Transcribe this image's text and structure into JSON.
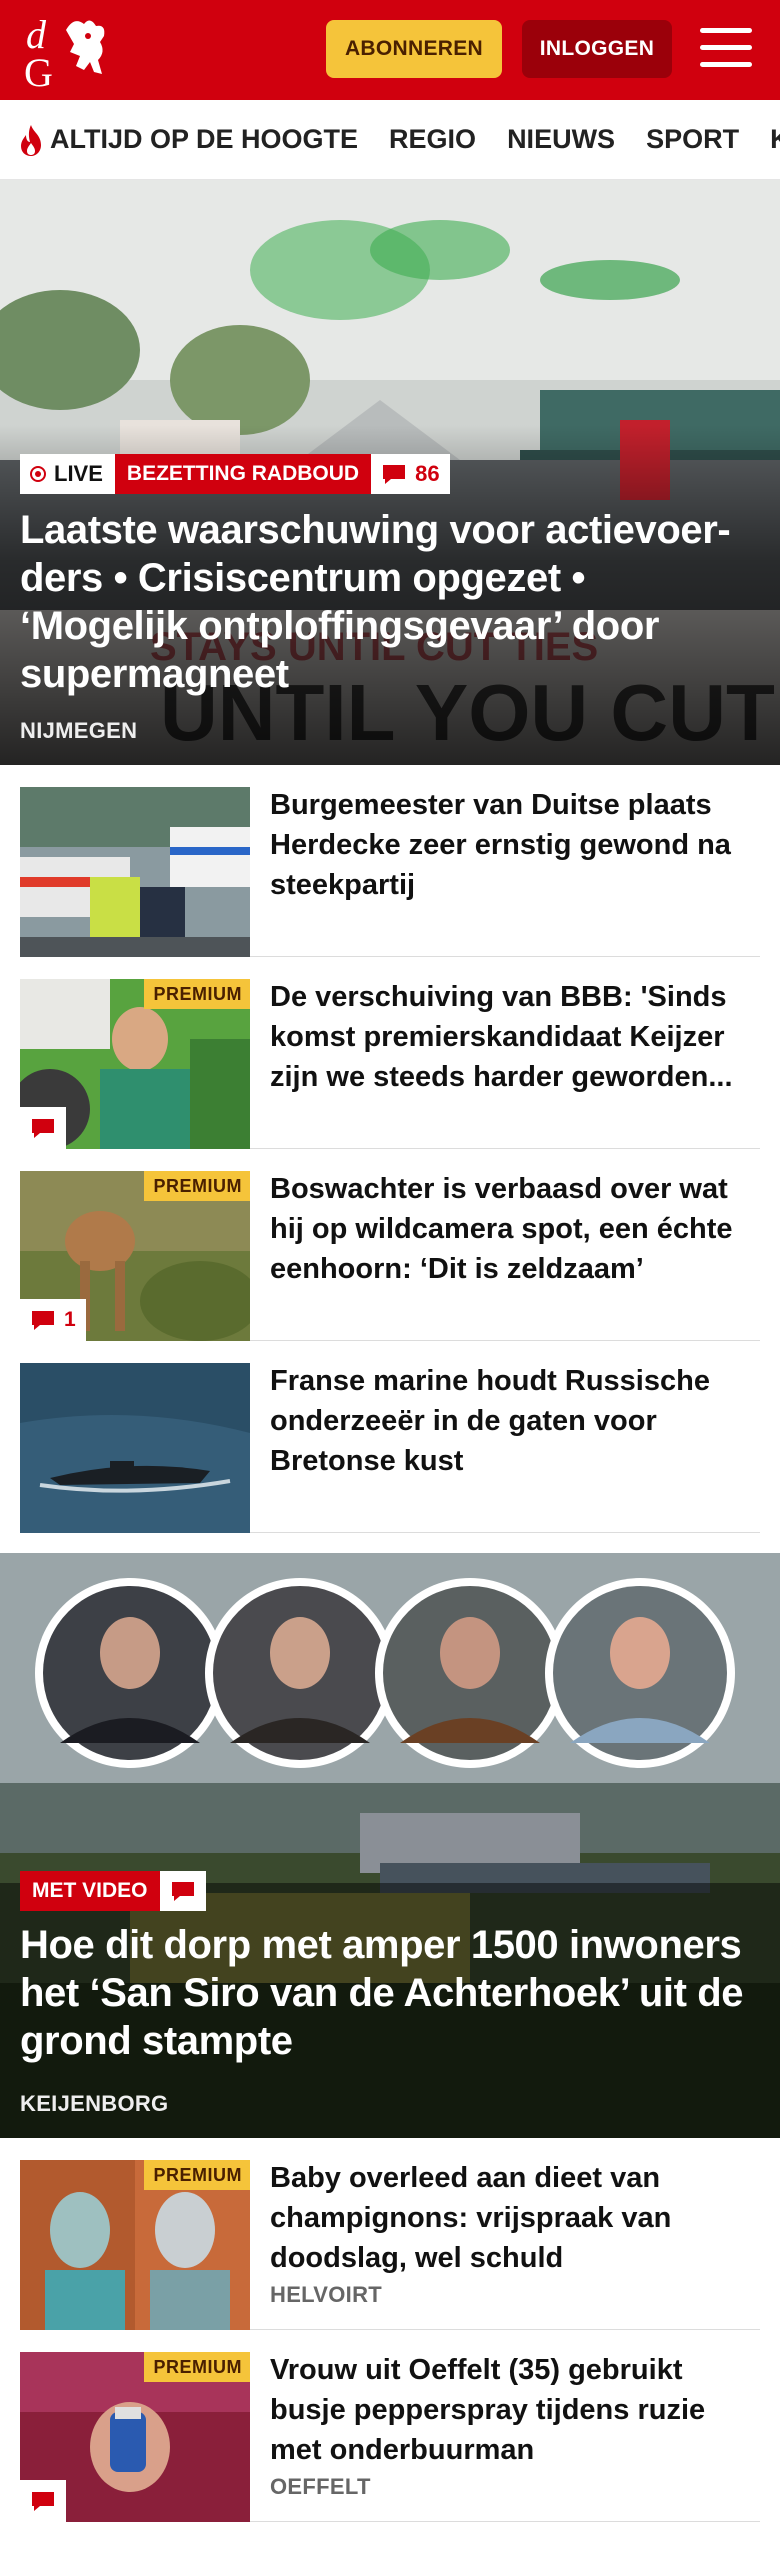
{
  "header": {
    "subscribe_label": "ABONNEREN",
    "login_label": "INLOGGEN",
    "brand_color": "#d0000e",
    "accent_color": "#f5c43a"
  },
  "nav": {
    "items": [
      "ALTIJD OP DE HOOGTE",
      "REGIO",
      "NIEUWS",
      "SPORT",
      "KIJK"
    ]
  },
  "hero": {
    "live_label": "LIVE",
    "tag": "BEZETTING RADBOUD",
    "comment_count": "86",
    "title": "Laatste waarschuwing voor actievoer­ders • Crisiscentrum opgezet • ‘Mogelijk ontploffingsgevaar’ door supermagneet",
    "location": "NIJMEGEN"
  },
  "articles_top": [
    {
      "title": "Burgemeester van Duitse plaats Herdecke zeer ernstig gewond na steekpartij",
      "premium": "",
      "comments": "",
      "location": ""
    },
    {
      "title": "De verschuiving van BBB: 'Sinds komst premierskandidaat Keijzer zijn we steeds harder geworden...",
      "premium": "PREMIUM",
      "comments": "",
      "location": ""
    },
    {
      "title": "Boswachter is verbaasd over wat hij op wildcamera spot, een échte eenhoorn: ‘Dit is zeldzaam’",
      "premium": "PREMIUM",
      "comments": "1",
      "location": ""
    },
    {
      "title": "Franse marine houdt Russische onderzeeër in de gaten voor Bretonse kust",
      "premium": "",
      "comments": "",
      "location": ""
    }
  ],
  "feature": {
    "tag": "MET VIDEO",
    "title": "Hoe dit dorp met amper 1500 inwoners het ‘San Siro van de Achterhoek’ uit de grond stampte",
    "location": "KEIJENBORG"
  },
  "articles_bottom": [
    {
      "title": "Baby overleed aan dieet van champignons: vrijspraak van doodslag, wel schuld",
      "premium": "PREMIUM",
      "comments": "",
      "location": "HELVOIRT"
    },
    {
      "title": "Vrouw uit Oeffelt (35) gebruikt busje pepperspray tijdens ruzie met onderbuurman",
      "premium": "PREMIUM",
      "comments": "",
      "location": "OEFFELT"
    }
  ]
}
